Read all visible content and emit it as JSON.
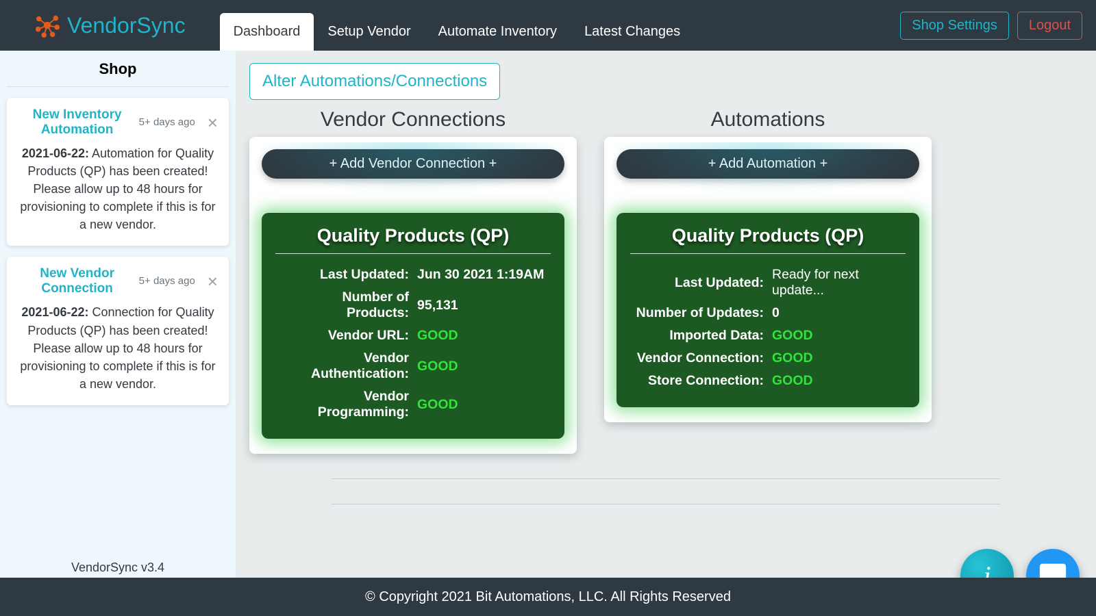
{
  "brand": {
    "name": "VendorSync"
  },
  "nav": {
    "tabs": [
      {
        "label": "Dashboard",
        "active": true
      },
      {
        "label": "Setup Vendor",
        "active": false
      },
      {
        "label": "Automate Inventory",
        "active": false
      },
      {
        "label": "Latest Changes",
        "active": false
      }
    ],
    "settings_label": "Shop Settings",
    "logout_label": "Logout"
  },
  "sidebar": {
    "title": "Shop",
    "version": "VendorSync v3.4",
    "notes": [
      {
        "title": "New Inventory Automation",
        "age": "5+ days ago",
        "date": "2021-06-22:",
        "body": "Automation for Quality Products (QP) has been created! Please allow up to 48 hours for provisioning to complete if this is for a new vendor."
      },
      {
        "title": "New Vendor Connection",
        "age": "5+ days ago",
        "date": "2021-06-22:",
        "body": "Connection for Quality Products (QP) has been created! Please allow up to 48 hours for provisioning to complete if this is for a new vendor."
      }
    ]
  },
  "main": {
    "alter_label": "Alter Automations/Connections",
    "vendor_connections": {
      "title": "Vendor Connections",
      "add_label": "+ Add Vendor Connection +",
      "card": {
        "title": "Quality Products (QP)",
        "rows": [
          {
            "k": "Last Updated:",
            "v": "Jun 30 2021 1:19AM",
            "cls": ""
          },
          {
            "k": "Number of Products:",
            "v": "95,131",
            "cls": ""
          },
          {
            "k": "Vendor URL:",
            "v": "GOOD",
            "cls": "good"
          },
          {
            "k": "Vendor Authentication:",
            "v": "GOOD",
            "cls": "good"
          },
          {
            "k": "Vendor Programming:",
            "v": "GOOD",
            "cls": "good"
          }
        ]
      }
    },
    "automations": {
      "title": "Automations",
      "add_label": "+ Add Automation +",
      "card": {
        "title": "Quality Products (QP)",
        "rows": [
          {
            "k": "Last Updated:",
            "v": "Ready for next update...",
            "cls": "ready"
          },
          {
            "k": "Number of Updates:",
            "v": "0",
            "cls": ""
          },
          {
            "k": "Imported Data:",
            "v": "GOOD",
            "cls": "good"
          },
          {
            "k": "Vendor Connection:",
            "v": "GOOD",
            "cls": "good"
          },
          {
            "k": "Store Connection:",
            "v": "GOOD",
            "cls": "good"
          }
        ]
      }
    }
  },
  "footer": {
    "text": "© Copyright 2021 Bit Automations, LLC. All Rights Reserved"
  },
  "fab": {
    "info": "i"
  }
}
